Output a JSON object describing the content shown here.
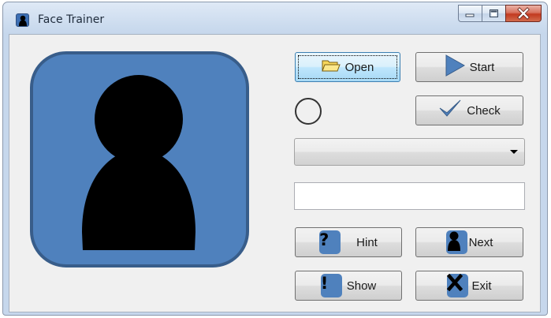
{
  "window": {
    "title": "Face Trainer"
  },
  "buttons": {
    "open": "Open",
    "start": "Start",
    "check": "Check",
    "hint": "Hint",
    "next": "Next",
    "show": "Show",
    "exit": "Exit"
  },
  "answer_dropdown": {
    "selected": ""
  },
  "answer_input": {
    "value": ""
  },
  "icons": {
    "app": "person-silhouette-icon",
    "open": "folder-icon",
    "start": "play-arrow-icon",
    "check": "checkmark-icon",
    "hint": "question-mark-icon",
    "next": "person-silhouette-icon",
    "show": "exclamation-icon",
    "exit": "x-mark-icon"
  },
  "colors": {
    "avatar_fill": "#4f81bd",
    "avatar_border": "#385d8a",
    "icon_blue": "#4f81bd",
    "close_red": "#c2391f"
  }
}
